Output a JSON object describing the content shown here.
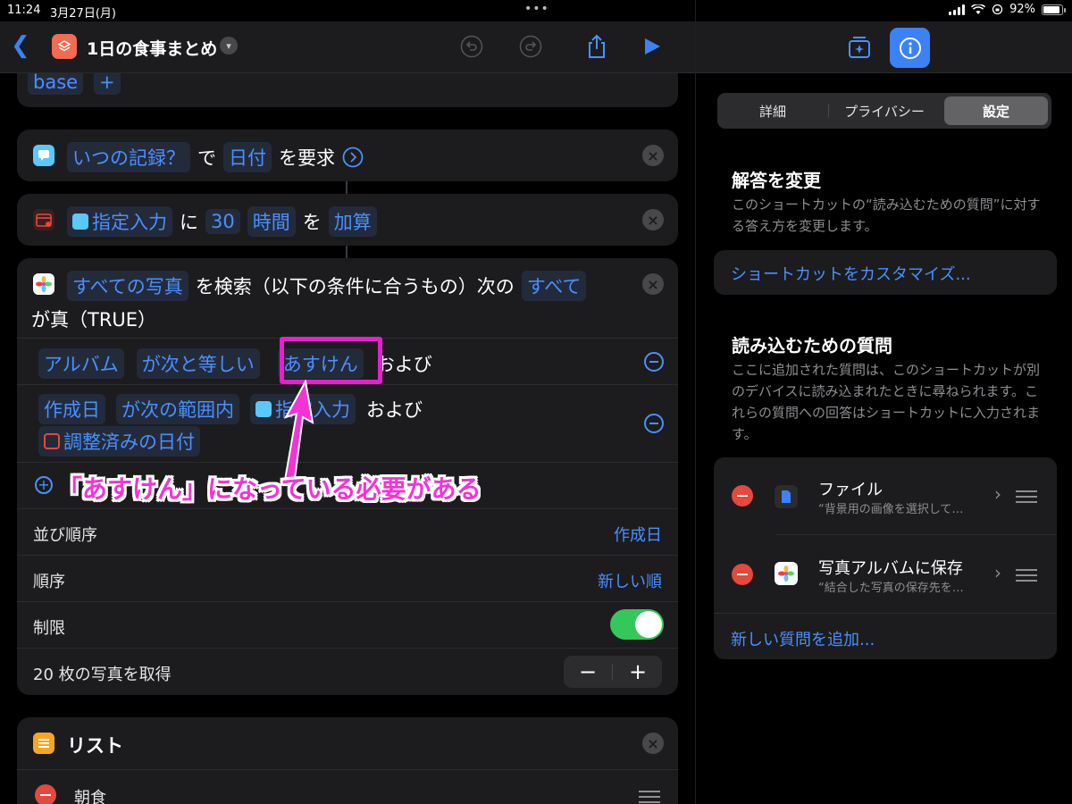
{
  "status": {
    "time": "11:24",
    "date": "3月27日(月)",
    "battery": "92%",
    "dots": "•••"
  },
  "toolbar": {
    "title": "1日の食事まとめ"
  },
  "cards": {
    "base_token": "base",
    "ask": {
      "token1": "いつの記録？",
      "t1": "で",
      "token2": "日付",
      "t2": "を要求"
    },
    "adjust": {
      "token1": "指定入力",
      "t1": "に",
      "num": "30",
      "unit": "時間",
      "t2": "を",
      "op": "加算"
    },
    "find": {
      "token1": "すべての写真",
      "t1": "を検索（以下の条件に合うもの）次の",
      "token2": "すべて",
      "t2": "が真（TRUE）",
      "cond1": {
        "a": "アルバム",
        "b": "が次と等しい",
        "c": "あすけん",
        "d": "および"
      },
      "cond2": {
        "a": "作成日",
        "b": "が次の範囲内",
        "c": "指定入力",
        "d": "および",
        "e": "調整済みの日付"
      },
      "sort_label": "並び順序",
      "sort_value": "作成日",
      "order_label": "順序",
      "order_value": "新しい順",
      "limit_label": "制限",
      "count_label": "20 枚の写真を取得"
    },
    "list": {
      "title": "リスト",
      "item1": "朝食"
    }
  },
  "annotation": "「あすけん」になっている必要がある",
  "right": {
    "tabs": [
      "詳細",
      "プライバシー",
      "設定"
    ],
    "section1": {
      "title": "解答を変更",
      "desc": "このショートカットの“読み込むための質問”に対する答え方を変更します。",
      "link": "ショートカットをカスタマイズ..."
    },
    "section2": {
      "title": "読み込むための質問",
      "desc": "ここに追加された質問は、このショートカットが別のデバイスに読み込まれたときに尋ねられます。これらの質問への回答はショートカットに入力されます。",
      "items": [
        {
          "title": "ファイル",
          "sub": "“背景用の画像を選択して…"
        },
        {
          "title": "写真アルバムに保存",
          "sub": "“結合した写真の保存先を…"
        }
      ],
      "add": "新しい質問を追加..."
    }
  },
  "colors": {
    "accent": "#4a90ff",
    "annotation": "#f233d6",
    "toggle_on": "#34c759",
    "danger": "#e5483c"
  },
  "limit_enabled": true
}
